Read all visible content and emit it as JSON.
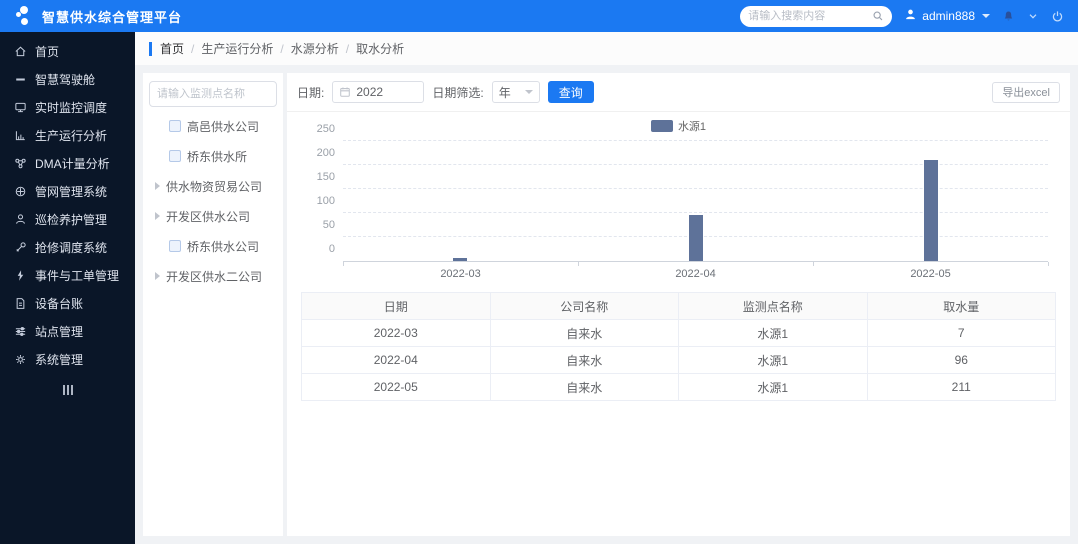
{
  "app": {
    "title": "智慧供水综合管理平台",
    "search_placeholder": "请输入搜索内容",
    "username": "admin888"
  },
  "colors": {
    "accent": "#1b79f2",
    "sidebar_bg": "#0a1628",
    "bar": "#5e7299"
  },
  "sidebar": {
    "items": [
      {
        "label": "首页",
        "icon": "home-icon"
      },
      {
        "label": "智慧驾驶舱",
        "icon": "dashboard-icon"
      },
      {
        "label": "实时监控调度",
        "icon": "monitor-icon"
      },
      {
        "label": "生产运行分析",
        "icon": "chart-icon"
      },
      {
        "label": "DMA计量分析",
        "icon": "dma-icon"
      },
      {
        "label": "管网管理系统",
        "icon": "pipe-network-icon"
      },
      {
        "label": "巡检养护管理",
        "icon": "person-icon"
      },
      {
        "label": "抢修调度系统",
        "icon": "wrench-icon"
      },
      {
        "label": "事件与工单管理",
        "icon": "event-icon"
      },
      {
        "label": "设备台账",
        "icon": "ledger-icon"
      },
      {
        "label": "站点管理",
        "icon": "sliders-icon"
      },
      {
        "label": "系统管理",
        "icon": "gear-icon"
      }
    ]
  },
  "breadcrumb": {
    "items": [
      "首页",
      "生产运行分析",
      "水源分析",
      "取水分析"
    ],
    "separator": "/"
  },
  "tree": {
    "search_placeholder": "请输入监测点名称",
    "items": [
      {
        "label": "高邑供水公司",
        "control": "checkbox"
      },
      {
        "label": "桥东供水所",
        "control": "checkbox"
      },
      {
        "label": "供水物资贸易公司",
        "control": "arrow"
      },
      {
        "label": "开发区供水公司",
        "control": "arrow"
      },
      {
        "label": "桥东供水公司",
        "control": "checkbox"
      },
      {
        "label": "开发区供水二公司",
        "control": "arrow"
      }
    ]
  },
  "filters": {
    "date_label": "日期:",
    "date_value": "2022",
    "period_label": "日期筛选:",
    "period_value": "年",
    "query_label": "查询",
    "export_label": "导出excel"
  },
  "chart_data": {
    "type": "bar",
    "categories": [
      "2022-03",
      "2022-04",
      "2022-05"
    ],
    "series": [
      {
        "name": "水源1",
        "values": [
          7,
          96,
          211
        ],
        "color": "#5e7299"
      }
    ],
    "title": "",
    "xlabel": "",
    "ylabel": "",
    "ylim": [
      0,
      250
    ],
    "ytick_step": 50,
    "grid": "dashed-horizontal",
    "legend_position": "top-center"
  },
  "table": {
    "headers": [
      "日期",
      "公司名称",
      "监测点名称",
      "取水量"
    ],
    "rows": [
      [
        "2022-03",
        "自来水",
        "水源1",
        "7"
      ],
      [
        "2022-04",
        "自来水",
        "水源1",
        "96"
      ],
      [
        "2022-05",
        "自来水",
        "水源1",
        "211"
      ]
    ]
  }
}
